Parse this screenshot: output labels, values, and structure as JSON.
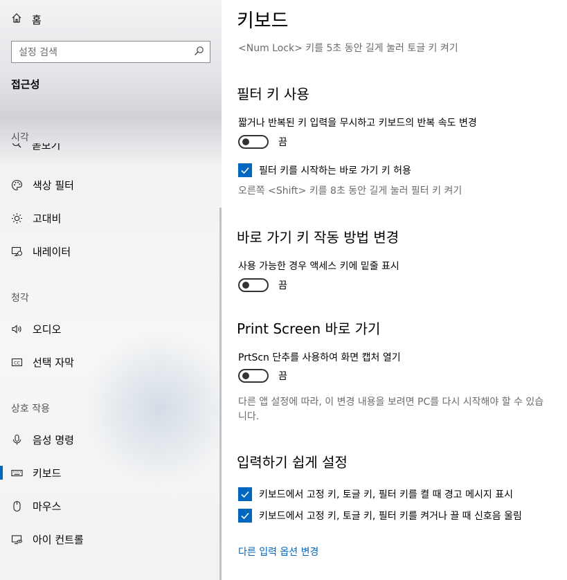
{
  "sidebar": {
    "home_label": "홈",
    "search_placeholder": "설정 검색",
    "title": "접근성",
    "clipped_label": "돋보기",
    "sections": {
      "vision": "시각",
      "hearing": "청각",
      "interaction": "상호 작용"
    },
    "items": [
      {
        "label": "색상 필터",
        "icon": "palette-icon"
      },
      {
        "label": "고대비",
        "icon": "sun-icon"
      },
      {
        "label": "내레이터",
        "icon": "narrator-icon"
      },
      {
        "label": "오디오",
        "icon": "speaker-icon"
      },
      {
        "label": "선택 자막",
        "icon": "cc-icon"
      },
      {
        "label": "음성 명령",
        "icon": "microphone-icon"
      },
      {
        "label": "키보드",
        "icon": "keyboard-icon",
        "active": true
      },
      {
        "label": "마우스",
        "icon": "mouse-icon"
      },
      {
        "label": "아이 컨트롤",
        "icon": "eye-control-icon"
      }
    ]
  },
  "main": {
    "title": "키보드",
    "numlock_hint": "<Num Lock> 키를 5초 동안 길게 눌러 토글 키 켜기",
    "filter_keys": {
      "heading": "필터 키 사용",
      "desc": "짧거나 반복된 키 입력을 무시하고 키보드의 반복 속도 변경",
      "toggle_state": "끔",
      "shortcut_label": "필터 키를 시작하는 바로 가기 키 허용",
      "shortcut_hint": "오른쪽 <Shift> 키를 8초 동안 길게 눌러 필터 키 켜기"
    },
    "shortcuts": {
      "heading": "바로 가기 키 작동 방법 변경",
      "desc": "사용 가능한 경우 액세스 키에 밑줄 표시",
      "toggle_state": "끔"
    },
    "print_screen": {
      "heading": "Print Screen 바로 가기",
      "desc": "PrtScn 단추를 사용하여 화면 캡처 열기",
      "toggle_state": "끔",
      "note": "다른 앱 설정에 따라, 이 변경 내용을 보려면 PC를 다시 시작해야 할 수 있습니다."
    },
    "typing": {
      "heading": "입력하기 쉽게 설정",
      "check1": "키보드에서 고정 키, 토글 키, 필터 키를 켤 때 경고 메시지 표시",
      "check2": "키보드에서 고정 키, 토글 키, 필터 키를 켜거나 끌 때 신호음 울림",
      "link": "다른 입력 옵션 변경"
    }
  },
  "colors": {
    "accent": "#0067c0",
    "hint": "#6b6b6b"
  }
}
